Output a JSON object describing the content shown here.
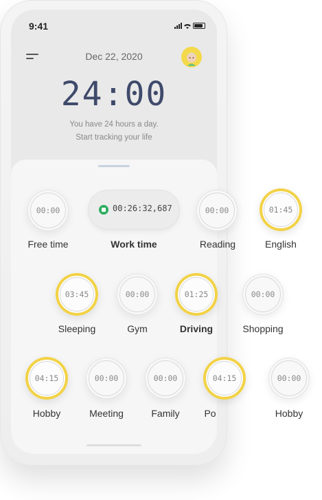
{
  "status": {
    "time": "9:41"
  },
  "header": {
    "date": "Dec 22, 2020"
  },
  "hero": {
    "big_time": "24:00",
    "line1": "You have 24 hours a day.",
    "line2": "Start tracking your life"
  },
  "running": {
    "time": "00:26:32,687",
    "label": "Work time"
  },
  "timers": [
    {
      "label": "Free time",
      "time": "00:00",
      "active": false
    },
    {
      "label": "Reading",
      "time": "00:00",
      "active": false
    },
    {
      "label": "English",
      "time": "01:45",
      "active": true
    },
    {
      "label": "Sleeping",
      "time": "03:45",
      "active": true
    },
    {
      "label": "Gym",
      "time": "00:00",
      "active": false
    },
    {
      "label": "Driving",
      "time": "01:25",
      "active": true
    },
    {
      "label": "Shopping",
      "time": "00:00",
      "active": false
    },
    {
      "label": "Hobby",
      "time": "04:15",
      "active": true
    },
    {
      "label": "Meeting",
      "time": "00:00",
      "active": false
    },
    {
      "label": "Family",
      "time": "00:00",
      "active": false
    },
    {
      "label": "Po",
      "time": "04:15",
      "active": true
    },
    {
      "label": "Hobby",
      "time": "00:00",
      "active": false
    }
  ],
  "colors": {
    "accent": "#f2d246",
    "running": "#2fae62",
    "digits": "#3f4a6b"
  },
  "icons": [
    "menu-icon",
    "avatar",
    "signal-icon",
    "wifi-icon",
    "battery-icon",
    "stop-icon"
  ]
}
